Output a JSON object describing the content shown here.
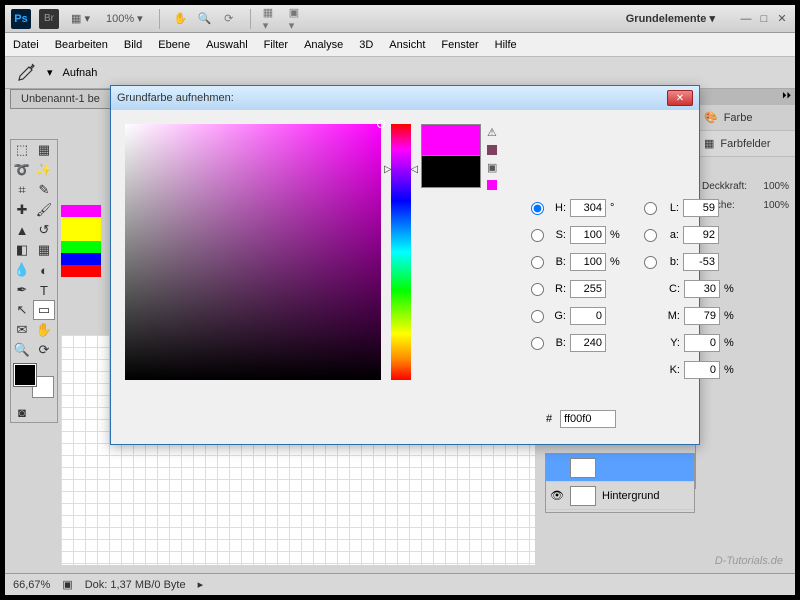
{
  "titlebar": {
    "zoom_dropdown": "100% ▾",
    "workspace": "Grundelemente ▾"
  },
  "menubar": [
    "Datei",
    "Bearbeiten",
    "Bild",
    "Ebene",
    "Auswahl",
    "Filter",
    "Analyse",
    "3D",
    "Ansicht",
    "Fenster",
    "Hilfe"
  ],
  "optionsbar": {
    "tool_options": "Aufnah"
  },
  "doc_tab": "Unbenannt-1 be",
  "panels": {
    "collapse": "⏵⏵",
    "color": "Farbe",
    "swatches": "Farbfelder",
    "opacity_label": "Deckkraft:",
    "opacity_value": "100%",
    "fill_label": "Fläche:",
    "fill_value": "100%"
  },
  "layers": {
    "bg_layer": "Hintergrund"
  },
  "swatch_colors": [
    "#ff00ff",
    "#ffff00",
    "#ffff00",
    "#00ff00",
    "#0000ff",
    "#ff0000"
  ],
  "statusbar": {
    "zoom": "66,67%",
    "doc_info": "Dok: 1,37 MB/0 Byte"
  },
  "dialog": {
    "title": "Grundfarbe aufnehmen:",
    "H_label": "H:",
    "H": "304",
    "H_unit": "°",
    "S_label": "S:",
    "S": "100",
    "S_unit": "%",
    "Bb_label": "B:",
    "Bb": "100",
    "Bb_unit": "%",
    "R_label": "R:",
    "R": "255",
    "G_label": "G:",
    "G": "0",
    "B_label": "B:",
    "B": "240",
    "L_label": "L:",
    "L": "59",
    "a_label": "a:",
    "a": "92",
    "b_label": "b:",
    "b": "-53",
    "C_label": "C:",
    "C": "30",
    "C_unit": "%",
    "M_label": "M:",
    "M": "79",
    "M_unit": "%",
    "Y_label": "Y:",
    "Y": "0",
    "Y_unit": "%",
    "K_label": "K:",
    "K": "0",
    "K_unit": "%",
    "hex_label": "#",
    "hex": "ff00f0"
  },
  "watermark": "D-Tutorials.de"
}
